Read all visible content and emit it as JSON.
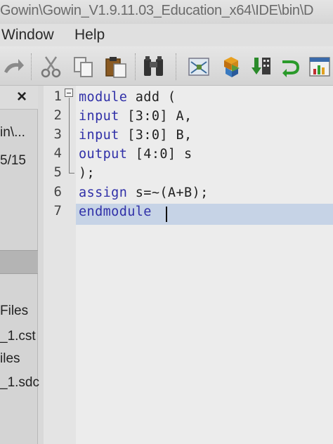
{
  "window": {
    "title": "Gowin\\Gowin_V1.9.11.03_Education_x64\\IDE\\bin\\D"
  },
  "menu": {
    "items": [
      "Window",
      "Help"
    ]
  },
  "toolbar": {
    "icons": [
      "redo-icon",
      "cut-icon",
      "copy-icon",
      "paste-icon",
      "find-icon",
      "schematic-icon",
      "ip-core-icon",
      "program-device-icon",
      "run-icon",
      "report-icon"
    ]
  },
  "left_panel": {
    "items": [
      "in\\...",
      "5/15",
      "Files",
      "_1.cst",
      "iles",
      "_1.sdc"
    ]
  },
  "editor": {
    "line_numbers": [
      "1",
      "2",
      "3",
      "4",
      "5",
      "6",
      "7"
    ],
    "lines": [
      {
        "kw": "module",
        "rest": " add ("
      },
      {
        "kw": "input",
        "rest": " [3:0] A,"
      },
      {
        "kw": "input",
        "rest": " [3:0] B,"
      },
      {
        "kw": "output",
        "rest": " [4:0] s"
      },
      {
        "kw": "",
        "rest": ");"
      },
      {
        "kw": "assign",
        "rest": " s=~(A+B);"
      },
      {
        "kw": "endmodule",
        "rest": ""
      }
    ]
  },
  "colors": {
    "keyword": "#3030a8",
    "selection": "#c6d3e6",
    "editor_bg": "#ececec"
  }
}
